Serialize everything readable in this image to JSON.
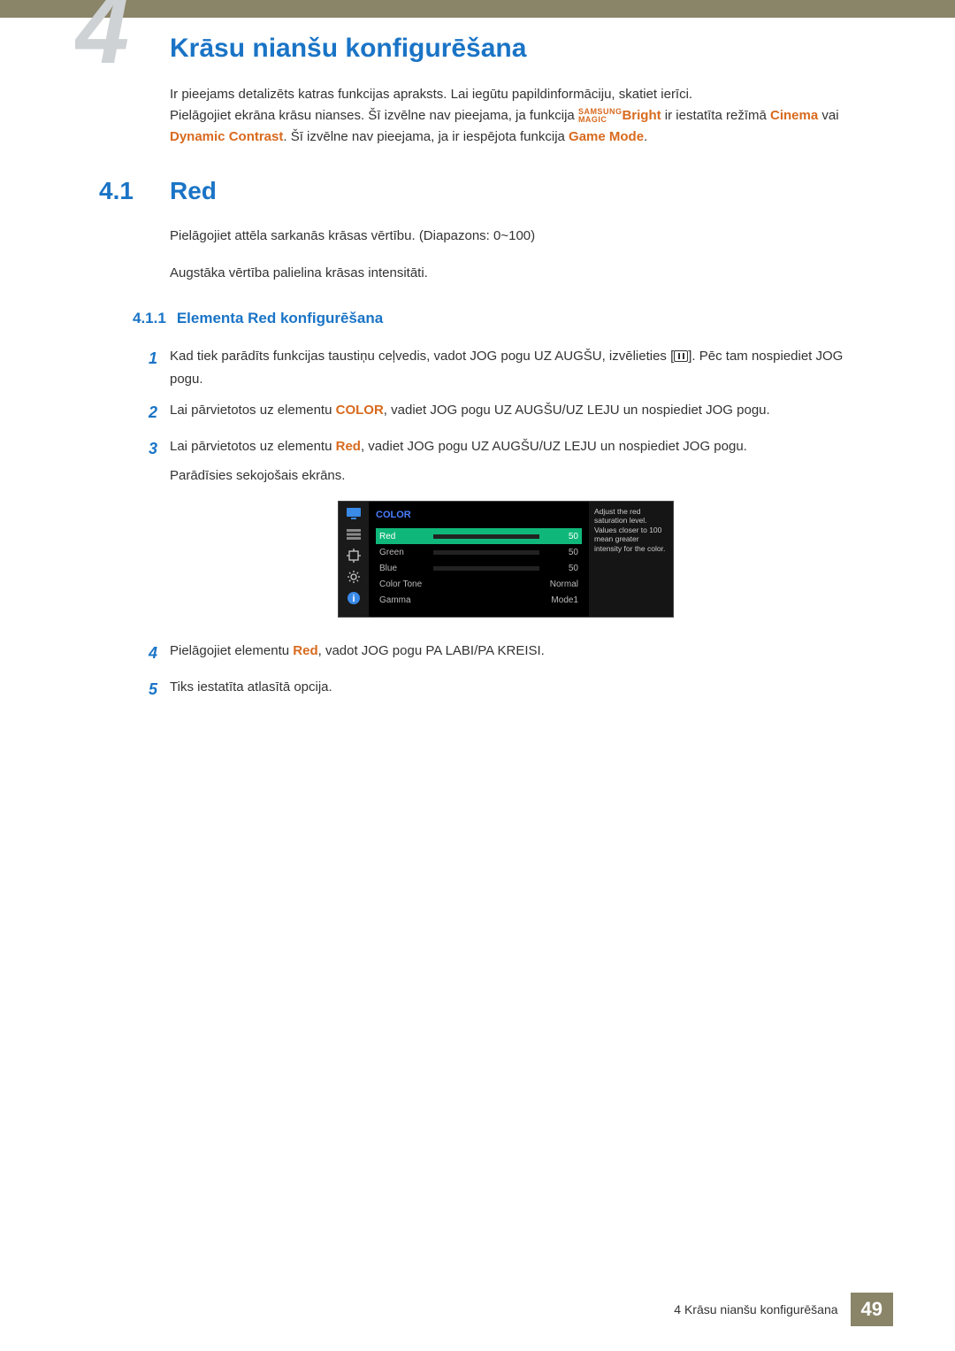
{
  "chapter": {
    "number_glyph": "4",
    "title": "Krāsu nianšu konfigurēšana"
  },
  "intro": {
    "line1": "Ir pieejams detalizēts katras funkcijas apraksts. Lai iegūtu papildinformāciju, skatiet ierīci.",
    "line2a": "Pielāgojiet ekrāna krāsu nianses. Šī izvēlne nav pieejama, ja funkcija ",
    "samsung": "SAMSUNG",
    "magic": "MAGIC",
    "bright": "Bright",
    "line2b": " ir iestatīta režīmā ",
    "cinema": "Cinema",
    "or": " vai ",
    "dyn": "Dynamic Contrast",
    "line2c": ". Šī izvēlne nav pieejama, ja ir iespējota funkcija ",
    "game": "Game Mode",
    "period": "."
  },
  "section": {
    "num": "4.1",
    "title": "Red",
    "p1": "Pielāgojiet attēla sarkanās krāsas vērtību. (Diapazons: 0~100)",
    "p2": "Augstāka vērtība palielina krāsas intensitāti."
  },
  "subsection": {
    "num": "4.1.1",
    "title": "Elementa Red konfigurēšana"
  },
  "steps": {
    "s1a": "Kad tiek parādīts funkcijas taustiņu ceļvedis, vadot JOG pogu UZ AUGŠU, izvēlieties [",
    "s1b": "]. Pēc tam nospiediet JOG pogu.",
    "s2a": "Lai pārvietotos uz elementu ",
    "s2_color": "COLOR",
    "s2b": ", vadiet JOG pogu UZ AUGŠU/UZ LEJU un nospiediet JOG pogu.",
    "s3a": "Lai pārvietotos uz elementu ",
    "s3_red": "Red",
    "s3b": ", vadiet JOG pogu UZ AUGŠU/UZ LEJU un nospiediet JOG pogu.",
    "s3c": "Parādīsies sekojošais ekrāns.",
    "s4a": "Pielāgojiet elementu ",
    "s4_red": "Red",
    "s4b": ", vadot JOG pogu PA LABI/PA KREISI.",
    "s5": "Tiks iestatīta atlasītā opcija."
  },
  "osd": {
    "title": "COLOR",
    "rows": [
      {
        "label": "Red",
        "val": "50",
        "barColor": "#e03030",
        "pct": 50,
        "selected": true
      },
      {
        "label": "Green",
        "val": "50",
        "barColor": "#2db84a",
        "pct": 50,
        "selected": false
      },
      {
        "label": "Blue",
        "val": "50",
        "barColor": "#3a6ae8",
        "pct": 50,
        "selected": false
      },
      {
        "label": "Color Tone",
        "val": "Normal",
        "barColor": "",
        "pct": 0,
        "selected": false
      },
      {
        "label": "Gamma",
        "val": "Mode1",
        "barColor": "",
        "pct": 0,
        "selected": false
      }
    ],
    "help": "Adjust the red saturation level. Values closer to 100 mean greater intensity for the color."
  },
  "footer": {
    "text": "4 Krāsu nianšu konfigurēšana",
    "page": "49"
  }
}
